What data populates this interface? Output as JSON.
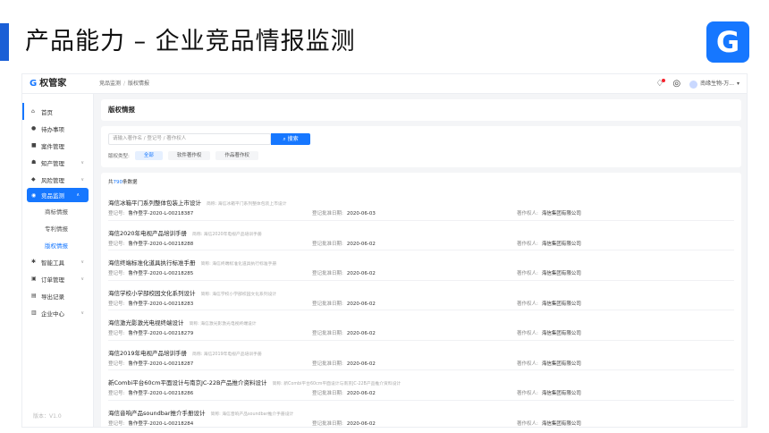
{
  "slide": {
    "title": "产品能力 – 企业竞品情报监测",
    "badge_glyph": "G"
  },
  "app": {
    "logo_text": "权管家",
    "breadcrumb": [
      "竞品监测",
      "版权情报"
    ],
    "user_name": "南缘生物-万...",
    "version": "版本：V1.0",
    "sidebar": [
      {
        "label": "首页",
        "icon": "home-icon",
        "glyph": "⌂"
      },
      {
        "label": "待办事项",
        "icon": "todo-icon",
        "glyph": "●"
      },
      {
        "label": "案件管理",
        "icon": "case-icon",
        "glyph": "■"
      },
      {
        "label": "知产管理",
        "icon": "ip-icon",
        "glyph": "☗"
      },
      {
        "label": "风险管理",
        "icon": "shield-icon",
        "glyph": "◆"
      },
      {
        "label": "竞品监测",
        "icon": "monitor-icon",
        "glyph": "◉"
      },
      {
        "label": "商标情报"
      },
      {
        "label": "专利情报"
      },
      {
        "label": "版权情报"
      },
      {
        "label": "智能工具",
        "icon": "tool-icon",
        "glyph": "✱"
      },
      {
        "label": "订单管理",
        "icon": "order-icon",
        "glyph": "▣"
      },
      {
        "label": "导出记录",
        "icon": "export-icon",
        "glyph": "▤"
      },
      {
        "label": "企业中心",
        "icon": "company-icon",
        "glyph": "▥"
      }
    ],
    "page_title": "版权情报",
    "search": {
      "placeholder": "请输入著作名 / 登记号 / 著作权人",
      "button": "搜索"
    },
    "type_label": "版权类型:",
    "types": [
      "全部",
      "软件著作权",
      "作品著作权"
    ],
    "total": {
      "prefix": "共",
      "count": "790",
      "suffix": "条数据"
    },
    "field_labels": {
      "reg_no": "登记号:",
      "approve_date": "登记批准日期:",
      "owner": "著作权人:"
    },
    "records": [
      {
        "title": "海信冰箱平门系列整体包装上市设计",
        "subtitle": "简称: 海信冰箱平门系列整体包装上市设计",
        "reg_no": "鲁作登字-2020-L-00218387",
        "date": "2020-06-03",
        "owner": "海信集团有限公司"
      },
      {
        "title": "海信2020年电视产品培训手册",
        "subtitle": "简称: 海信2020年电视产品培训手册",
        "reg_no": "鲁作登字-2020-L-00218288",
        "date": "2020-06-02",
        "owner": "海信集团有限公司"
      },
      {
        "title": "海信终端标准化道具执行标准手册",
        "subtitle": "简称: 海信终端标准化道具执行标准手册",
        "reg_no": "鲁作登字-2020-L-00218285",
        "date": "2020-06-02",
        "owner": "海信集团有限公司"
      },
      {
        "title": "海信学校小学部校园文化系列设计",
        "subtitle": "简称: 海信学校小学部校园文化系列设计",
        "reg_no": "鲁作登字-2020-L-00218283",
        "date": "2020-06-02",
        "owner": "海信集团有限公司"
      },
      {
        "title": "海信激光影激光电视终端设计",
        "subtitle": "简称: 海信激光影激光电视终端设计",
        "reg_no": "鲁作登字-2020-L-00218279",
        "date": "2020-06-02",
        "owner": "海信集团有限公司"
      },
      {
        "title": "海信2019年电视产品培训手册",
        "subtitle": "简称: 海信2019年电视产品培训手册",
        "reg_no": "鲁作登字-2020-L-00218287",
        "date": "2020-06-02",
        "owner": "海信集团有限公司"
      },
      {
        "title": "新Combi平台60cm平面设计与南京JC-22B产品推介资料设计",
        "subtitle": "简称: 新Combi平台60cm平面设计与南京JC-22B产品推介资料设计",
        "reg_no": "鲁作登字-2020-L-00218286",
        "date": "2020-06-02",
        "owner": "海信集团有限公司"
      },
      {
        "title": "海信音响产品soundbar推介手册设计",
        "subtitle": "简称: 海信音响产品soundbar推介手册设计",
        "reg_no": "鲁作登字-2020-L-00218284",
        "date": "2020-06-02",
        "owner": "海信集团有限公司"
      }
    ]
  }
}
